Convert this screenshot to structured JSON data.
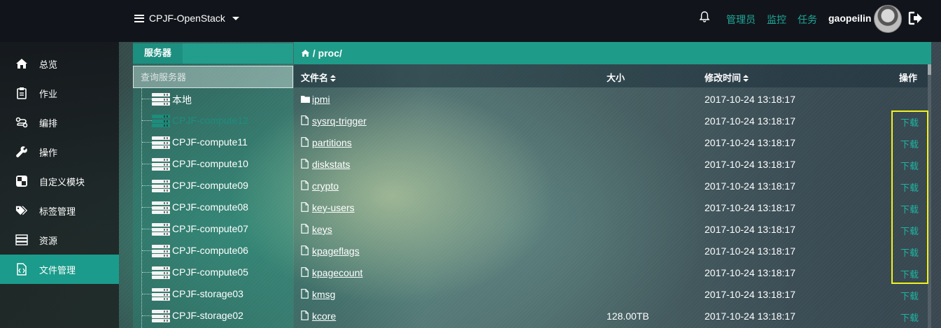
{
  "header": {
    "brand": "CPJF-OpenStack",
    "nav": [
      "管理员",
      "监控",
      "任务"
    ],
    "username": "gaopeilin",
    "icons": [
      "menu-icon",
      "bell-icon",
      "avatar",
      "logout-icon"
    ],
    "accent_color": "#1fa99a"
  },
  "sidebar": {
    "items": [
      {
        "label": "总览",
        "icon": "home-icon"
      },
      {
        "label": "作业",
        "icon": "clipboard-icon"
      },
      {
        "label": "编排",
        "icon": "flow-icon"
      },
      {
        "label": "操作",
        "icon": "wrench-icon"
      },
      {
        "label": "自定义模块",
        "icon": "module-icon"
      },
      {
        "label": "标签管理",
        "icon": "tags-icon"
      },
      {
        "label": "资源",
        "icon": "server-icon"
      },
      {
        "label": "文件管理",
        "icon": "file-code-icon",
        "active": true
      }
    ]
  },
  "servers": {
    "tab_label": "服务器",
    "search_placeholder": "查询服务器",
    "selected": "CPJF-compute12",
    "items": [
      "本地",
      "CPJF-compute12",
      "CPJF-compute11",
      "CPJF-compute10",
      "CPJF-compute09",
      "CPJF-compute08",
      "CPJF-compute07",
      "CPJF-compute06",
      "CPJF-compute05",
      "CPJF-storage03",
      "CPJF-storage02"
    ]
  },
  "files": {
    "path": "/ proc/",
    "columns": {
      "name": "文件名",
      "size": "大小",
      "mtime": "修改时间",
      "actions": "操作"
    },
    "rows": [
      {
        "name": "ipmi",
        "type": "folder",
        "size": "",
        "mtime": "2017-10-24 13:18:17",
        "action": ""
      },
      {
        "name": "sysrq-trigger",
        "type": "file",
        "size": "",
        "mtime": "2017-10-24 13:18:17",
        "action": "下载"
      },
      {
        "name": "partitions",
        "type": "file",
        "size": "",
        "mtime": "2017-10-24 13:18:17",
        "action": "下载"
      },
      {
        "name": "diskstats",
        "type": "file",
        "size": "",
        "mtime": "2017-10-24 13:18:17",
        "action": "下载"
      },
      {
        "name": "crypto",
        "type": "file",
        "size": "",
        "mtime": "2017-10-24 13:18:17",
        "action": "下载"
      },
      {
        "name": "key-users",
        "type": "file",
        "size": "",
        "mtime": "2017-10-24 13:18:17",
        "action": "下载"
      },
      {
        "name": "keys",
        "type": "file",
        "size": "",
        "mtime": "2017-10-24 13:18:17",
        "action": "下载"
      },
      {
        "name": "kpageflags",
        "type": "file",
        "size": "",
        "mtime": "2017-10-24 13:18:17",
        "action": "下载"
      },
      {
        "name": "kpagecount",
        "type": "file",
        "size": "",
        "mtime": "2017-10-24 13:18:17",
        "action": "下载"
      },
      {
        "name": "kmsg",
        "type": "file",
        "size": "",
        "mtime": "2017-10-24 13:18:17",
        "action": "下载"
      },
      {
        "name": "kcore",
        "type": "file",
        "size": "128.00TB",
        "mtime": "2017-10-24 13:18:17",
        "action": "下载"
      }
    ]
  },
  "highlight_color": "#f2f21c"
}
